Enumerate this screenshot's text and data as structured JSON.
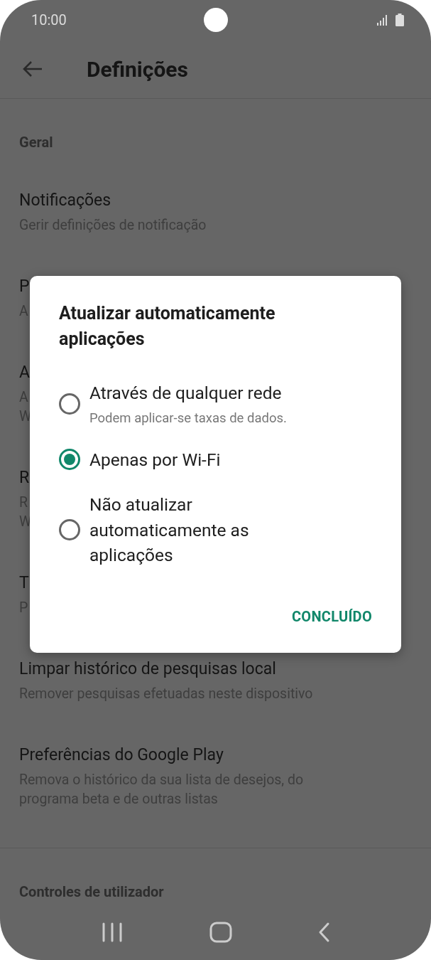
{
  "status_bar": {
    "time": "10:00"
  },
  "toolbar": {
    "title": "Definições"
  },
  "sections": [
    {
      "header": "Geral",
      "items": [
        {
          "title": "Notificações",
          "subtitle_lines": [
            "Gerir definições de notificação"
          ]
        },
        {
          "title": "P",
          "subtitle_lines": [
            "A"
          ]
        },
        {
          "title": "A",
          "subtitle_lines": [
            "A",
            "W"
          ]
        },
        {
          "title": "R",
          "subtitle_lines": [
            "R",
            "W"
          ]
        },
        {
          "title": "T",
          "subtitle_lines": [
            "P"
          ]
        },
        {
          "title": "Limpar histórico de pesquisas local",
          "subtitle_lines": [
            "Remover pesquisas efetuadas neste dispositivo"
          ]
        },
        {
          "title": "Preferências do Google Play",
          "subtitle_lines": [
            "Remova o histórico da sua lista de desejos, do",
            "programa beta e de outras listas"
          ]
        }
      ]
    },
    {
      "header": "Controles de utilizador"
    }
  ],
  "dialog": {
    "title": "Atualizar automaticamente aplicações",
    "options": [
      {
        "label": "Através de qualquer rede",
        "description": "Podem aplicar-se taxas de dados.",
        "selected": false
      },
      {
        "label": "Apenas por Wi-Fi",
        "selected": true
      },
      {
        "label": "Não atualizar automaticamente as aplicações",
        "selected": false
      }
    ],
    "button": "CONCLUÍDO"
  }
}
